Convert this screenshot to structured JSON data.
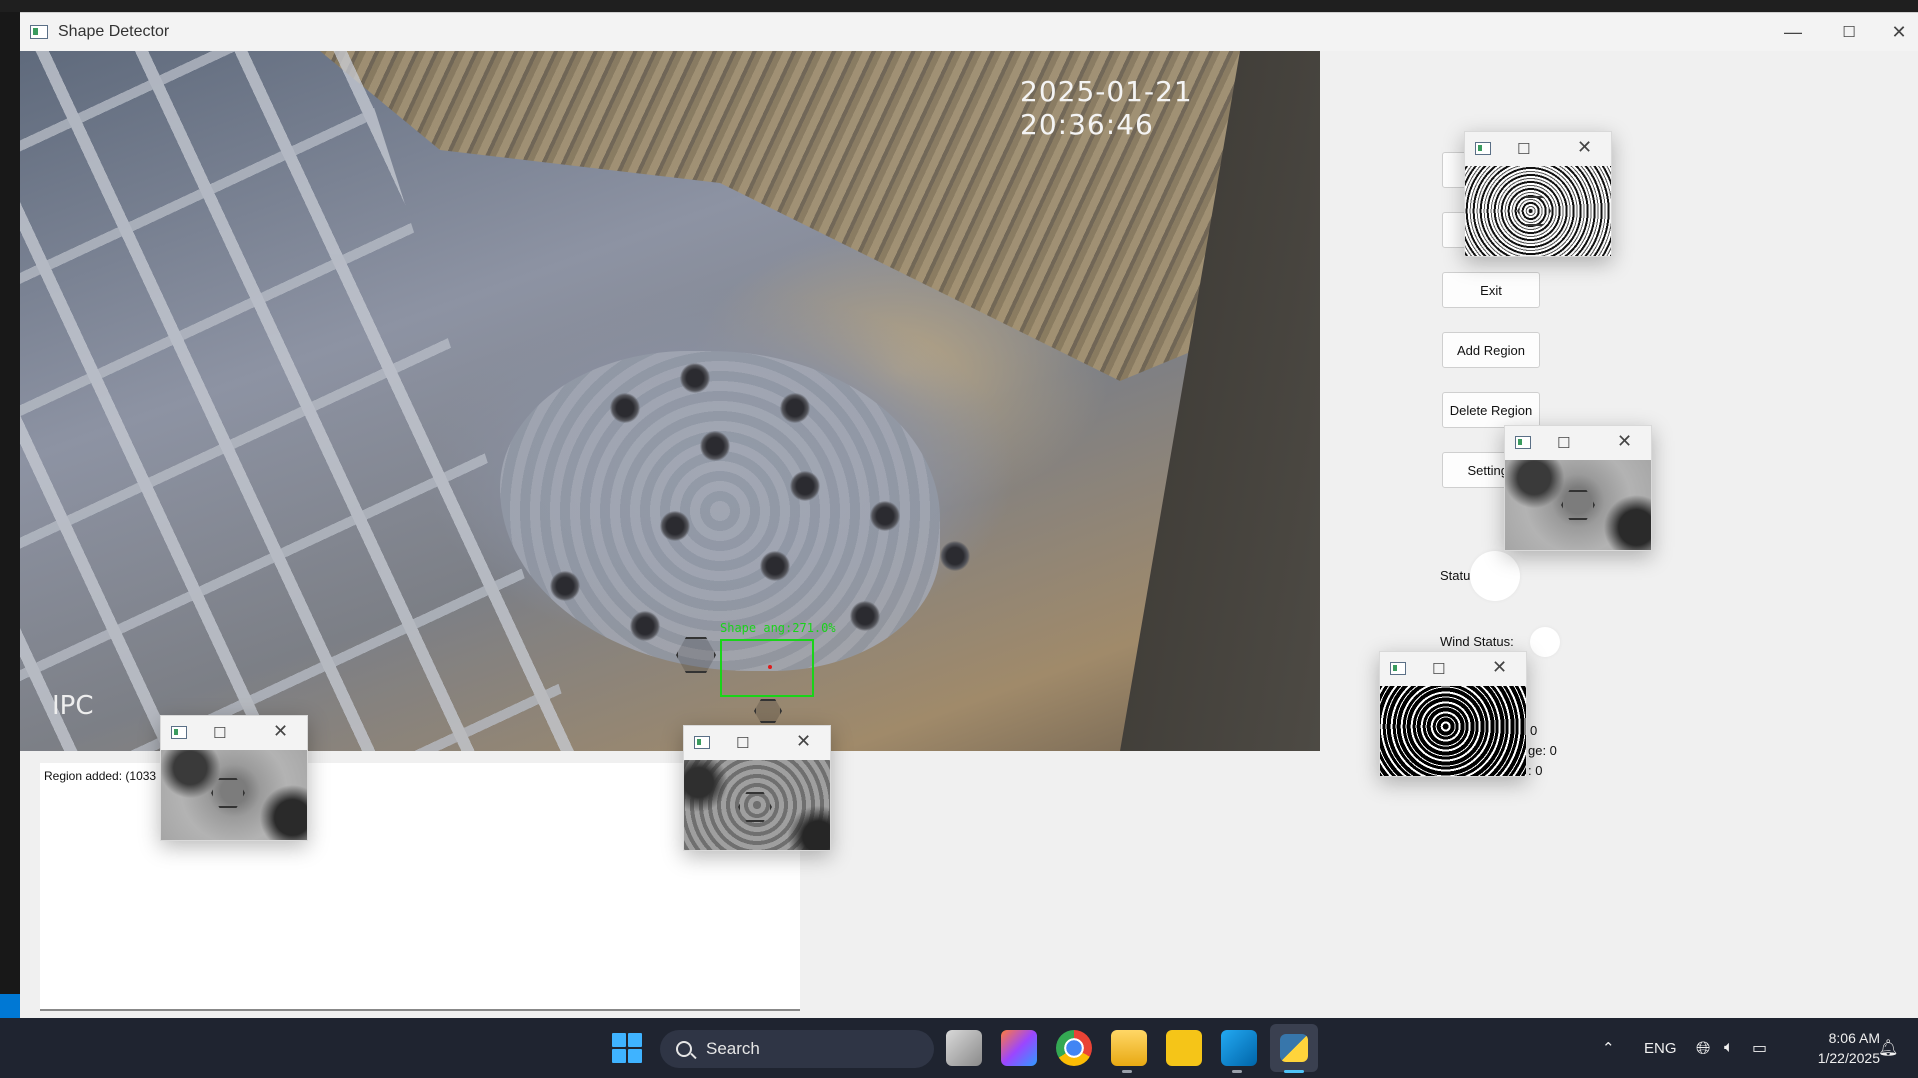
{
  "window": {
    "title": "Shape Detector",
    "minimize_symbol": "—",
    "maximize_symbol": "☐",
    "close_symbol": "✕"
  },
  "camera": {
    "timestamp": "2025-01-21 20:36:46",
    "watermark": "IPC",
    "detection_label": "Shape ang:271.0%"
  },
  "log": {
    "line": "Region added: (1033"
  },
  "controls": {
    "btn1_label": "S",
    "btn2_label": "S",
    "exit_label": "Exit",
    "add_region_label": "Add Region",
    "delete_region_label": "Delete Region",
    "settings_label": "Settings",
    "status_label": "Status:",
    "wind_status_label": "Wind Status:",
    "stat_line1": "0",
    "stat_line2": "ge: 0",
    "stat_line3": ": 0"
  },
  "popups": {
    "maximize_symbol": "☐",
    "close_symbol": "✕"
  },
  "taskbar": {
    "search_placeholder": "Search",
    "lang": "ENG",
    "time": "8:06 AM",
    "date": "1/22/2025"
  },
  "colors": {
    "detection_box": "#19d419",
    "taskbar_bg": "#1f2430",
    "window_bg": "#f0f0f0"
  }
}
